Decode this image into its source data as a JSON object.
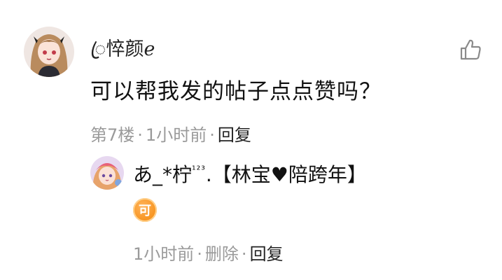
{
  "comment": {
    "username": "ꦿ悴颜ℯ",
    "text": "可以帮我发的帖子点点赞吗？",
    "floor": "第7楼",
    "time": "1小时前",
    "reply_label": "回复",
    "separator": "·"
  },
  "reply": {
    "username": "あ_*柠",
    "username_sup": "¹²³",
    "username_suffix": ".【林宝♥陪跨年】",
    "badge_text": "可",
    "time": "1小时前",
    "delete_label": "删除",
    "reply_label": "回复",
    "separator": "·"
  },
  "icons": {
    "like": "thumbs-up-icon",
    "badge": "level-badge-icon"
  },
  "colors": {
    "meta_gray": "#9a9a9a",
    "text_dark": "#222222",
    "badge_orange": "#f7931e"
  }
}
